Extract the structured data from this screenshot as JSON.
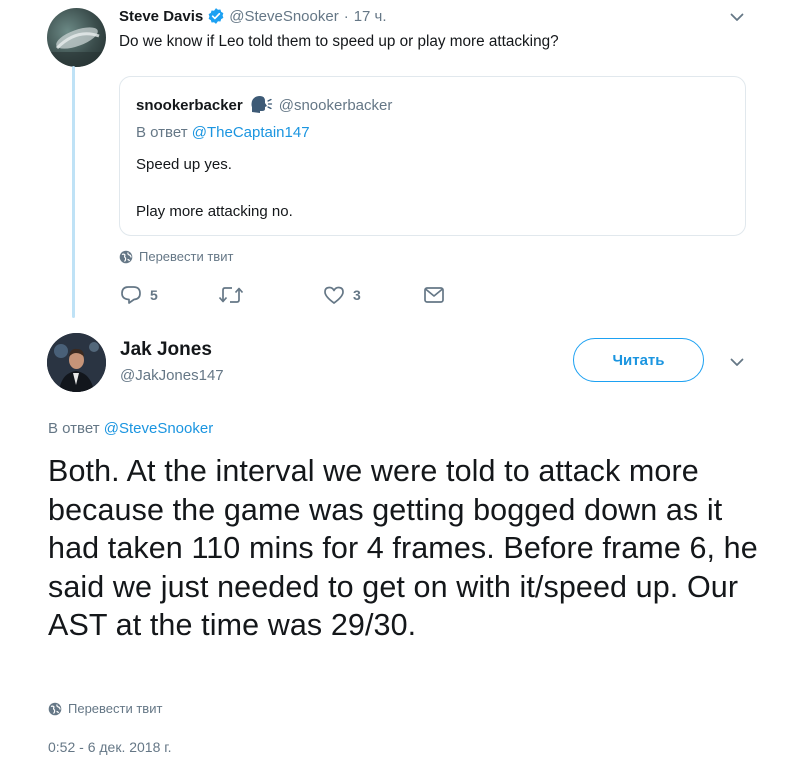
{
  "tweet1": {
    "author_name": "Steve Davis",
    "handle": "@SteveSnooker",
    "separator": "·",
    "time": "17 ч.",
    "text": "Do we know if Leo told them to speed up or play more attacking?",
    "quoted": {
      "author_name": "snookerbacker",
      "handle": "@snookerbacker",
      "reply_to_prefix": "В ответ",
      "reply_to_handle": "@TheCaptain147",
      "line1": "Speed up yes.",
      "line2": "Play more attacking no."
    },
    "translate_label": "Перевести твит",
    "actions": {
      "replies": "5",
      "likes": "3"
    }
  },
  "tweet2": {
    "author_name": "Jak Jones",
    "handle": "@JakJones147",
    "follow_label": "Читать",
    "reply_to_prefix": "В ответ",
    "reply_to_handle": "@SteveSnooker",
    "text": "Both. At the interval we were told to attack more because the game was getting bogged down as it had taken 110 mins for 4 frames. Before frame 6, he said we just needed to get on with it/speed up. Our AST at the time was 29/30.",
    "translate_label": "Перевести твит",
    "timestamp": "0:52 - 6 дек. 2018 г."
  },
  "colors": {
    "accent": "#1da1f2",
    "link": "#1b95e0",
    "muted": "#657786",
    "thread": "#bfe2f6"
  },
  "icons": [
    "verified-badge-icon",
    "chevron-down-icon",
    "speaking-head-emoji-icon",
    "globe-icon",
    "reply-icon",
    "retweet-icon",
    "like-icon",
    "direct-message-icon"
  ]
}
